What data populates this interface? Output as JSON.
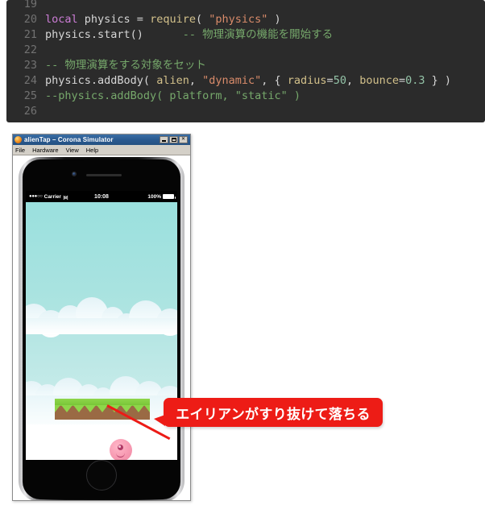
{
  "code_editor": {
    "name": "lua-code-snippet",
    "lines": [
      {
        "number": "19",
        "text": ""
      },
      {
        "number": "20",
        "text": "local physics = require( \"physics\" )"
      },
      {
        "number": "21",
        "text": "physics.start()      -- 物理演算の機能を開始する"
      },
      {
        "number": "22",
        "text": ""
      },
      {
        "number": "23",
        "text": "-- 物理演算をする対象をセット"
      },
      {
        "number": "24",
        "text": "physics.addBody( alien, \"dynamic\", { radius=50, bounce=0.3 } )"
      },
      {
        "number": "25",
        "text": "--physics.addBody( platform, \"static\" )"
      },
      {
        "number": "26",
        "text": ""
      }
    ],
    "tokens": {
      "l20": {
        "kw": "local",
        "var": " physics ",
        "eq": "= ",
        "fn": "require",
        "open": "( ",
        "str": "\"physics\"",
        "close": " )"
      },
      "l21": {
        "call": "physics.start()",
        "gap": "      ",
        "comment": "-- 物理演算の機能を開始する"
      },
      "l23": {
        "comment": "-- 物理演算をする対象をセット"
      },
      "l24": {
        "fn": "physics.addBody",
        "open": "( ",
        "arg1": "alien",
        "c1": ", ",
        "str": "\"dynamic\"",
        "c2": ", { ",
        "k1": "radius",
        "eq1": "=",
        "n1": "50",
        "c3": ", ",
        "k2": "bounce",
        "eq2": "=",
        "n2": "0.3",
        "close": " } )"
      },
      "l25": {
        "comment": "--physics.addBody( platform, \"static\" )"
      }
    },
    "colors": {
      "background": "#2b2b2b",
      "line_number": "#727272",
      "keyword": "#cc7dd6",
      "function": "#d2c08a",
      "string": "#d98b6a",
      "number": "#94c4a8",
      "comment": "#76a86b",
      "plain": "#d6d6d6"
    }
  },
  "simulator": {
    "title": "alienTap – Corona Simulator",
    "app_icon": "corona-app-icon",
    "menu": [
      {
        "label": "File"
      },
      {
        "label": "Hardware"
      },
      {
        "label": "View"
      },
      {
        "label": "Help"
      }
    ],
    "window_controls": [
      {
        "name": "minimize-button",
        "glyph": ""
      },
      {
        "name": "maximize-button",
        "glyph": ""
      },
      {
        "name": "close-button",
        "glyph": "✕"
      }
    ]
  },
  "device": {
    "name": "iphone-frame",
    "camera": "front-camera",
    "speaker": "earpiece-speaker",
    "home_button": "home-button"
  },
  "status_bar": {
    "signal_dots": "●●●○○",
    "carrier": "Carrier",
    "wifi_icon": "wifi-icon",
    "wifi_glyph": "᯼",
    "time": "10:08",
    "battery_percent": "100%",
    "battery_icon": "battery-full-icon"
  },
  "game": {
    "sky_top_color": "#9ae0de",
    "sky_bottom_color": "#d9f2f0",
    "cloud_color": "#ffffff",
    "platform": {
      "name": "platform-sprite",
      "grass_color": "#7fcb3d",
      "dirt_color": "#9a6a44"
    },
    "alien": {
      "name": "alien-sprite",
      "body_color": "#f79ab2",
      "eye_color": "#b03a66",
      "highlight_ring_color": "#ffffff"
    }
  },
  "annotation": {
    "callout_text": "エイリアンがすり抜けて落ちる",
    "callout_bg": "#ed1c16",
    "callout_fg": "#ffffff",
    "pointer_color": "#ec1b16"
  }
}
